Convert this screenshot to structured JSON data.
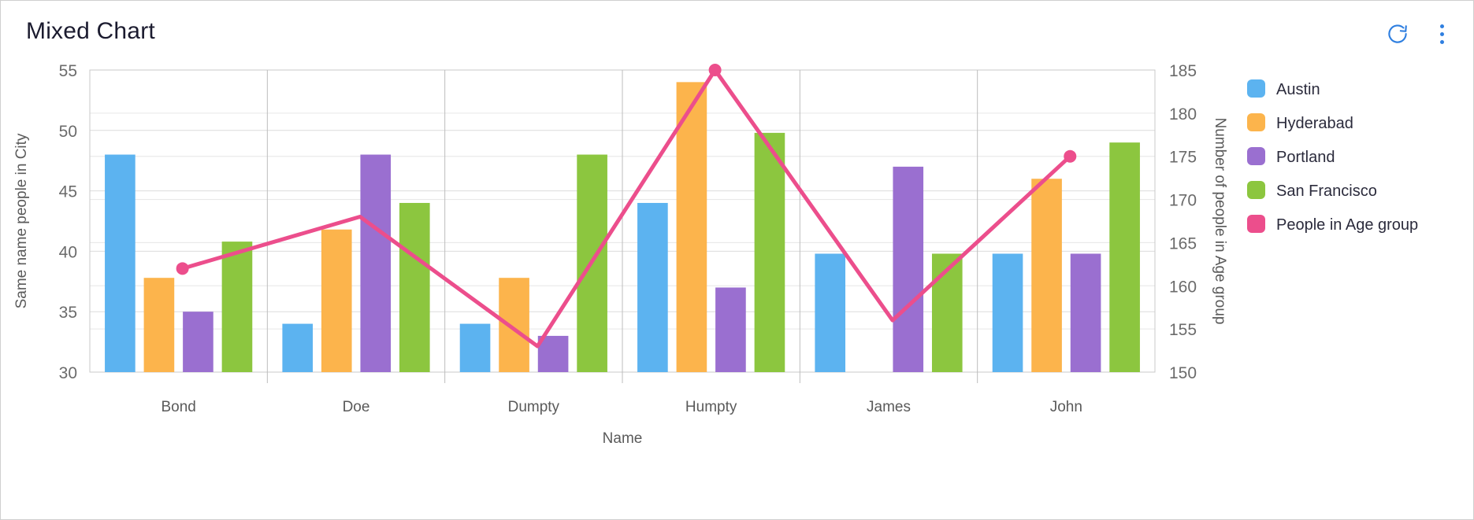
{
  "header": {
    "title": "Mixed Chart",
    "refresh_icon": "refresh-icon",
    "menu_icon": "kebab-menu-icon"
  },
  "legend": {
    "position": "right",
    "items": [
      {
        "label": "Austin",
        "color": "#5cb3f0"
      },
      {
        "label": "Hyderabad",
        "color": "#fcb44c"
      },
      {
        "label": "Portland",
        "color": "#9a6fd0"
      },
      {
        "label": "San Francisco",
        "color": "#8cc63f"
      },
      {
        "label": "People in Age group",
        "color": "#ec4e8c"
      }
    ]
  },
  "chart_data": {
    "type": "bar",
    "title": "Mixed Chart",
    "xlabel": "Name",
    "ylabel": "Same name people in City",
    "y2label": "Number of people in Age group",
    "categories": [
      "Bond",
      "Doe",
      "Dumpty",
      "Humpty",
      "James",
      "John"
    ],
    "ylim": [
      30,
      55
    ],
    "yticks": [
      30,
      35,
      40,
      45,
      50,
      55
    ],
    "y2lim": [
      150,
      185
    ],
    "y2ticks": [
      150,
      155,
      160,
      165,
      170,
      175,
      180,
      185
    ],
    "grid": true,
    "series": [
      {
        "name": "Austin",
        "type": "bar",
        "axis": "left",
        "color": "#5cb3f0",
        "values": [
          48,
          34,
          34,
          44,
          39.8,
          39.8
        ]
      },
      {
        "name": "Hyderabad",
        "type": "bar",
        "axis": "left",
        "color": "#fcb44c",
        "values": [
          37.8,
          41.8,
          37.8,
          54,
          null,
          46
        ]
      },
      {
        "name": "Portland",
        "type": "bar",
        "axis": "left",
        "color": "#9a6fd0",
        "values": [
          35,
          48,
          33,
          37,
          47,
          39.8
        ]
      },
      {
        "name": "San Francisco",
        "type": "bar",
        "axis": "left",
        "color": "#8cc63f",
        "values": [
          40.8,
          44,
          48,
          49.8,
          39.8,
          49
        ]
      },
      {
        "name": "People in Age group",
        "type": "line",
        "axis": "right",
        "color": "#ec4e8c",
        "values": [
          162,
          168,
          153,
          185,
          156,
          175
        ]
      }
    ]
  }
}
